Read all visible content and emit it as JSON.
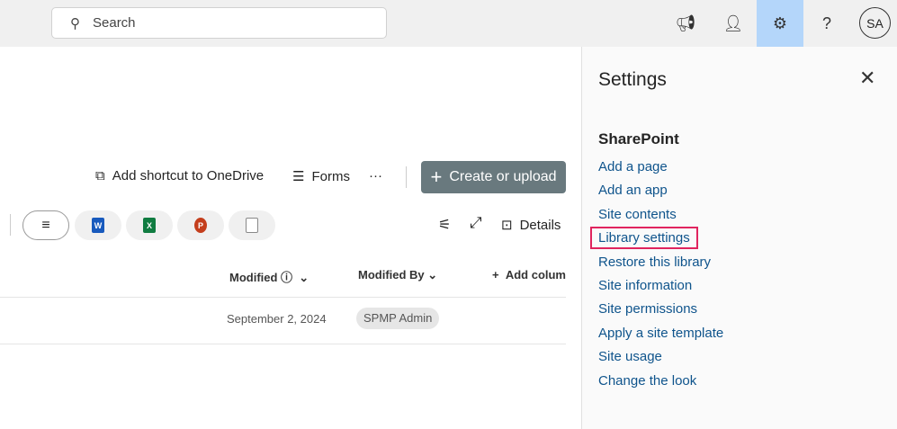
{
  "topbar": {
    "search_placeholder": "Search",
    "avatar": "SA"
  },
  "commands": {
    "shortcut": "Add shortcut to OneDrive",
    "forms": "Forms",
    "more": "···",
    "create": "Create or upload",
    "details": "Details"
  },
  "filters": [
    {
      "letter": "W",
      "color": "#185abd"
    },
    {
      "letter": "X",
      "color": "#107c41"
    },
    {
      "letter": "P",
      "color": "#c43e1c"
    }
  ],
  "columns": {
    "modified": "Modified",
    "modified_by": "Modified By",
    "add_column": "Add column"
  },
  "row": {
    "modified": "September 2, 2024",
    "modified_by": "SPMP Admin"
  },
  "settings": {
    "title": "Settings",
    "section": "SharePoint",
    "links": [
      "Add a page",
      "Add an app",
      "Site contents",
      "Library settings",
      "Restore this library",
      "Site information",
      "Site permissions",
      "Apply a site template",
      "Site usage",
      "Change the look"
    ]
  }
}
